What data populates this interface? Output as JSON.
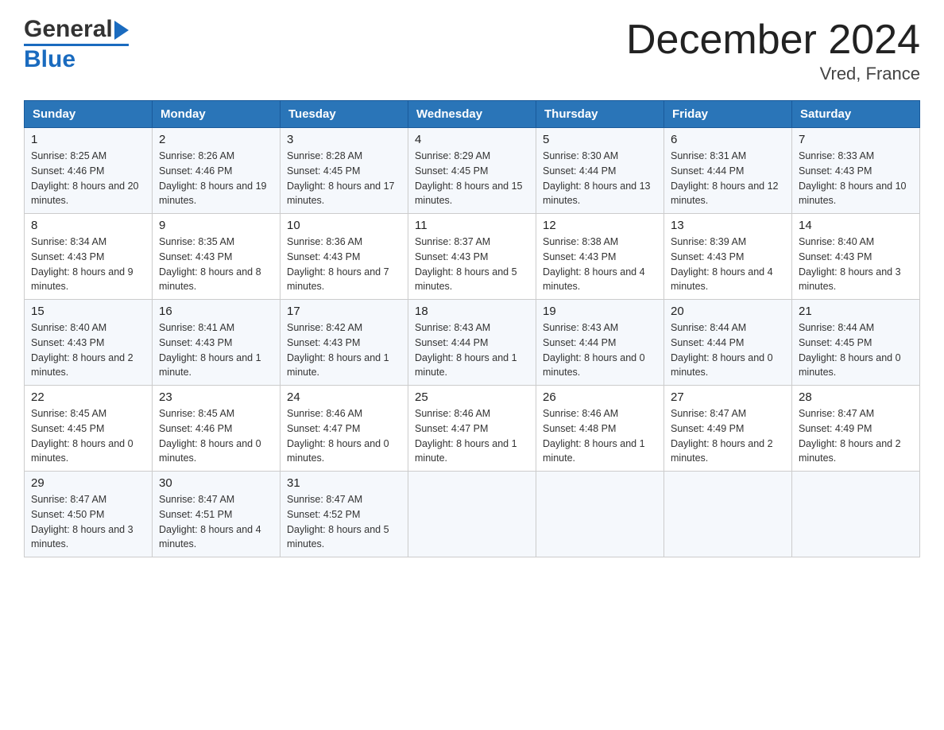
{
  "header": {
    "logo_general": "General",
    "logo_blue": "Blue",
    "title": "December 2024",
    "subtitle": "Vred, France"
  },
  "days_of_week": [
    "Sunday",
    "Monday",
    "Tuesday",
    "Wednesday",
    "Thursday",
    "Friday",
    "Saturday"
  ],
  "weeks": [
    [
      {
        "day": "1",
        "sunrise": "Sunrise: 8:25 AM",
        "sunset": "Sunset: 4:46 PM",
        "daylight": "Daylight: 8 hours and 20 minutes."
      },
      {
        "day": "2",
        "sunrise": "Sunrise: 8:26 AM",
        "sunset": "Sunset: 4:46 PM",
        "daylight": "Daylight: 8 hours and 19 minutes."
      },
      {
        "day": "3",
        "sunrise": "Sunrise: 8:28 AM",
        "sunset": "Sunset: 4:45 PM",
        "daylight": "Daylight: 8 hours and 17 minutes."
      },
      {
        "day": "4",
        "sunrise": "Sunrise: 8:29 AM",
        "sunset": "Sunset: 4:45 PM",
        "daylight": "Daylight: 8 hours and 15 minutes."
      },
      {
        "day": "5",
        "sunrise": "Sunrise: 8:30 AM",
        "sunset": "Sunset: 4:44 PM",
        "daylight": "Daylight: 8 hours and 13 minutes."
      },
      {
        "day": "6",
        "sunrise": "Sunrise: 8:31 AM",
        "sunset": "Sunset: 4:44 PM",
        "daylight": "Daylight: 8 hours and 12 minutes."
      },
      {
        "day": "7",
        "sunrise": "Sunrise: 8:33 AM",
        "sunset": "Sunset: 4:43 PM",
        "daylight": "Daylight: 8 hours and 10 minutes."
      }
    ],
    [
      {
        "day": "8",
        "sunrise": "Sunrise: 8:34 AM",
        "sunset": "Sunset: 4:43 PM",
        "daylight": "Daylight: 8 hours and 9 minutes."
      },
      {
        "day": "9",
        "sunrise": "Sunrise: 8:35 AM",
        "sunset": "Sunset: 4:43 PM",
        "daylight": "Daylight: 8 hours and 8 minutes."
      },
      {
        "day": "10",
        "sunrise": "Sunrise: 8:36 AM",
        "sunset": "Sunset: 4:43 PM",
        "daylight": "Daylight: 8 hours and 7 minutes."
      },
      {
        "day": "11",
        "sunrise": "Sunrise: 8:37 AM",
        "sunset": "Sunset: 4:43 PM",
        "daylight": "Daylight: 8 hours and 5 minutes."
      },
      {
        "day": "12",
        "sunrise": "Sunrise: 8:38 AM",
        "sunset": "Sunset: 4:43 PM",
        "daylight": "Daylight: 8 hours and 4 minutes."
      },
      {
        "day": "13",
        "sunrise": "Sunrise: 8:39 AM",
        "sunset": "Sunset: 4:43 PM",
        "daylight": "Daylight: 8 hours and 4 minutes."
      },
      {
        "day": "14",
        "sunrise": "Sunrise: 8:40 AM",
        "sunset": "Sunset: 4:43 PM",
        "daylight": "Daylight: 8 hours and 3 minutes."
      }
    ],
    [
      {
        "day": "15",
        "sunrise": "Sunrise: 8:40 AM",
        "sunset": "Sunset: 4:43 PM",
        "daylight": "Daylight: 8 hours and 2 minutes."
      },
      {
        "day": "16",
        "sunrise": "Sunrise: 8:41 AM",
        "sunset": "Sunset: 4:43 PM",
        "daylight": "Daylight: 8 hours and 1 minute."
      },
      {
        "day": "17",
        "sunrise": "Sunrise: 8:42 AM",
        "sunset": "Sunset: 4:43 PM",
        "daylight": "Daylight: 8 hours and 1 minute."
      },
      {
        "day": "18",
        "sunrise": "Sunrise: 8:43 AM",
        "sunset": "Sunset: 4:44 PM",
        "daylight": "Daylight: 8 hours and 1 minute."
      },
      {
        "day": "19",
        "sunrise": "Sunrise: 8:43 AM",
        "sunset": "Sunset: 4:44 PM",
        "daylight": "Daylight: 8 hours and 0 minutes."
      },
      {
        "day": "20",
        "sunrise": "Sunrise: 8:44 AM",
        "sunset": "Sunset: 4:44 PM",
        "daylight": "Daylight: 8 hours and 0 minutes."
      },
      {
        "day": "21",
        "sunrise": "Sunrise: 8:44 AM",
        "sunset": "Sunset: 4:45 PM",
        "daylight": "Daylight: 8 hours and 0 minutes."
      }
    ],
    [
      {
        "day": "22",
        "sunrise": "Sunrise: 8:45 AM",
        "sunset": "Sunset: 4:45 PM",
        "daylight": "Daylight: 8 hours and 0 minutes."
      },
      {
        "day": "23",
        "sunrise": "Sunrise: 8:45 AM",
        "sunset": "Sunset: 4:46 PM",
        "daylight": "Daylight: 8 hours and 0 minutes."
      },
      {
        "day": "24",
        "sunrise": "Sunrise: 8:46 AM",
        "sunset": "Sunset: 4:47 PM",
        "daylight": "Daylight: 8 hours and 0 minutes."
      },
      {
        "day": "25",
        "sunrise": "Sunrise: 8:46 AM",
        "sunset": "Sunset: 4:47 PM",
        "daylight": "Daylight: 8 hours and 1 minute."
      },
      {
        "day": "26",
        "sunrise": "Sunrise: 8:46 AM",
        "sunset": "Sunset: 4:48 PM",
        "daylight": "Daylight: 8 hours and 1 minute."
      },
      {
        "day": "27",
        "sunrise": "Sunrise: 8:47 AM",
        "sunset": "Sunset: 4:49 PM",
        "daylight": "Daylight: 8 hours and 2 minutes."
      },
      {
        "day": "28",
        "sunrise": "Sunrise: 8:47 AM",
        "sunset": "Sunset: 4:49 PM",
        "daylight": "Daylight: 8 hours and 2 minutes."
      }
    ],
    [
      {
        "day": "29",
        "sunrise": "Sunrise: 8:47 AM",
        "sunset": "Sunset: 4:50 PM",
        "daylight": "Daylight: 8 hours and 3 minutes."
      },
      {
        "day": "30",
        "sunrise": "Sunrise: 8:47 AM",
        "sunset": "Sunset: 4:51 PM",
        "daylight": "Daylight: 8 hours and 4 minutes."
      },
      {
        "day": "31",
        "sunrise": "Sunrise: 8:47 AM",
        "sunset": "Sunset: 4:52 PM",
        "daylight": "Daylight: 8 hours and 5 minutes."
      },
      {
        "day": "",
        "sunrise": "",
        "sunset": "",
        "daylight": ""
      },
      {
        "day": "",
        "sunrise": "",
        "sunset": "",
        "daylight": ""
      },
      {
        "day": "",
        "sunrise": "",
        "sunset": "",
        "daylight": ""
      },
      {
        "day": "",
        "sunrise": "",
        "sunset": "",
        "daylight": ""
      }
    ]
  ]
}
